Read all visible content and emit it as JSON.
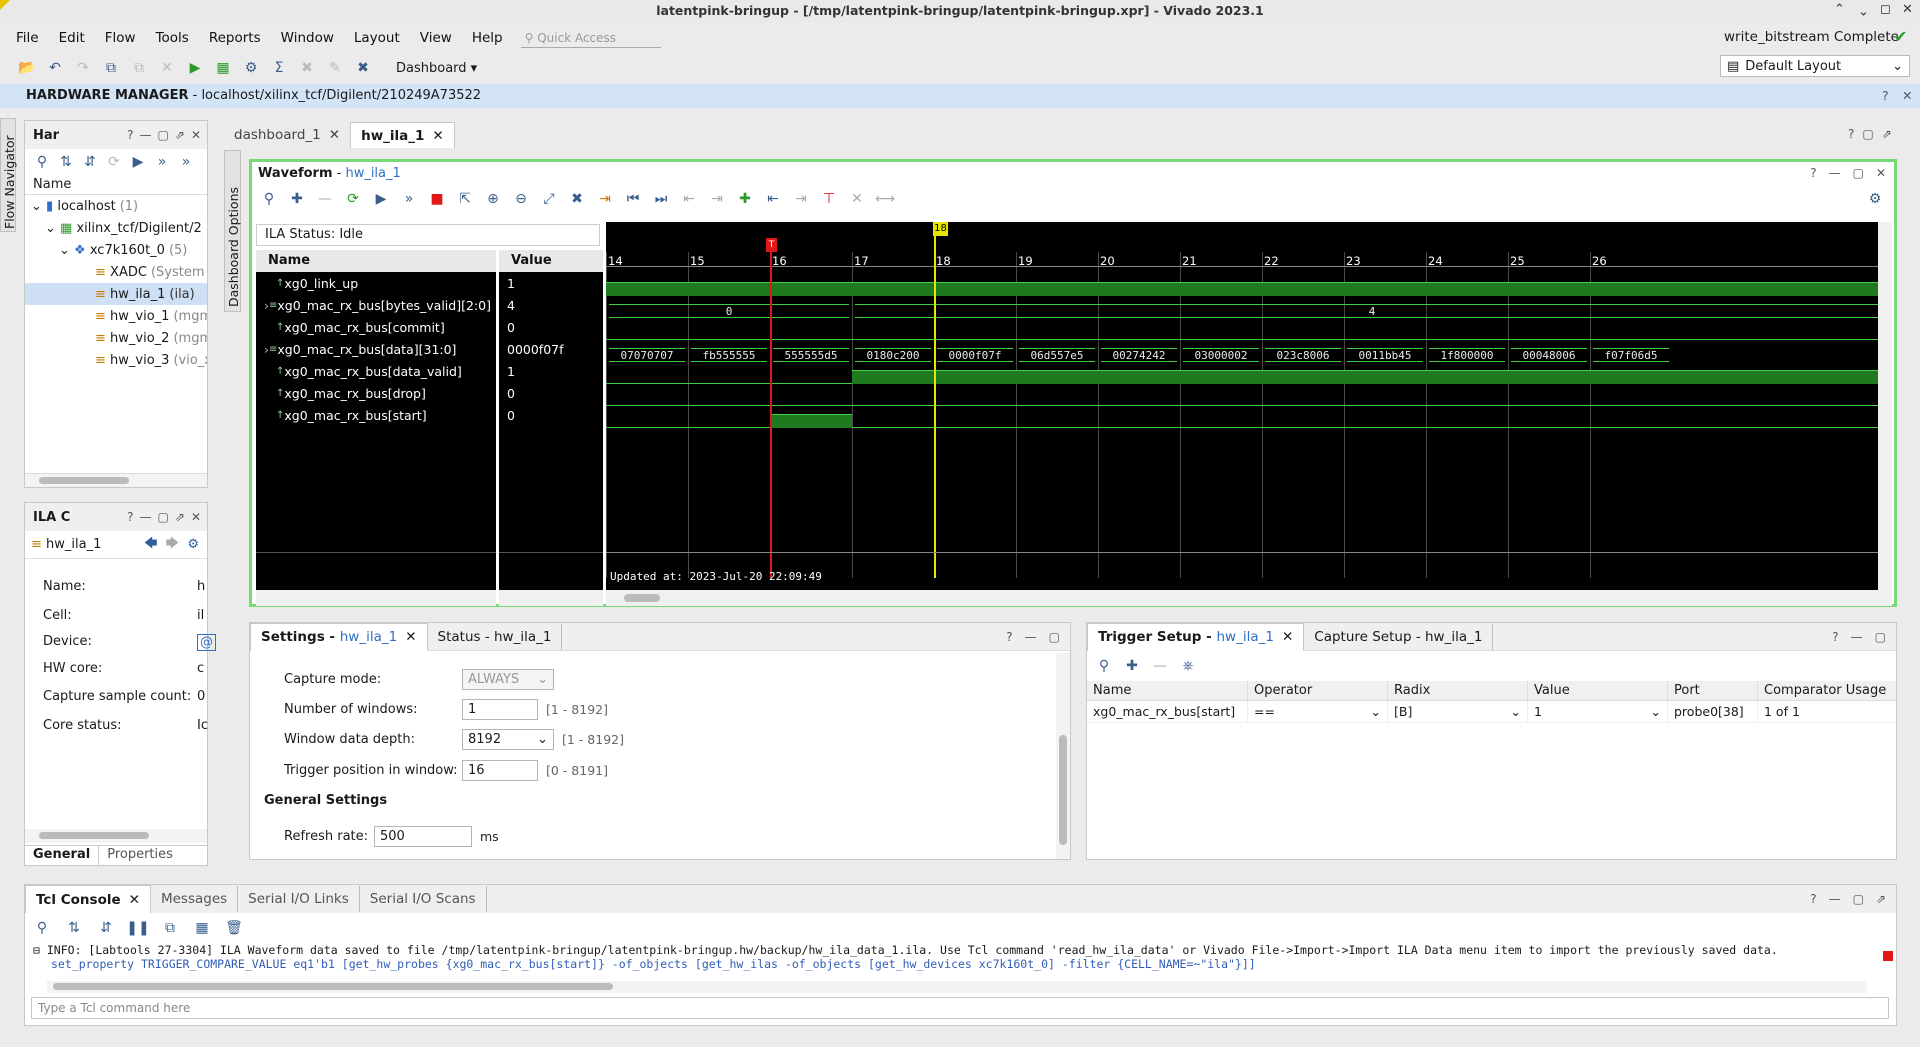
{
  "window": {
    "title": "latentpink-bringup - [/tmp/latentpink-bringup/latentpink-bringup.xpr] - Vivado 2023.1"
  },
  "menu": [
    "File",
    "Edit",
    "Flow",
    "Tools",
    "Reports",
    "Window",
    "Layout",
    "View",
    "Help"
  ],
  "quick_access": "Quick Access",
  "status_right": "write_bitstream Complete",
  "layout_select": "Default Layout",
  "dashboard_btn": "Dashboard",
  "hw_manager": {
    "title": "HARDWARE MANAGER",
    "path": " - localhost/xilinx_tcf/Digilent/210249A73522"
  },
  "flow_navigator": "Flow Navigator",
  "dashboard_options": "Dashboard Options",
  "hardware_panel": {
    "title": "Har",
    "col_name": "Name",
    "tree": [
      {
        "label": "localhost",
        "extra": "(1)"
      },
      {
        "label": "xilinx_tcf/Digilent/2",
        "extra": ""
      },
      {
        "label": "xc7k160t_0",
        "extra": "(5)"
      },
      {
        "label": "XADC",
        "extra": "(System"
      },
      {
        "label": "hw_ila_1",
        "extra": "(ila)"
      },
      {
        "label": "hw_vio_1",
        "extra": "(mgm"
      },
      {
        "label": "hw_vio_2",
        "extra": "(mgm"
      },
      {
        "label": "hw_vio_3",
        "extra": "(vio_x"
      }
    ]
  },
  "ila_core_panel": {
    "title": "ILA C",
    "selected": "hw_ila_1",
    "props": [
      {
        "k": "Name:",
        "v": "h"
      },
      {
        "k": "Cell:",
        "v": "il"
      },
      {
        "k": "Device:",
        "v": "@"
      },
      {
        "k": "HW core:",
        "v": "c"
      },
      {
        "k": "Capture sample count:",
        "v": "0"
      },
      {
        "k": "Core status:",
        "v": "Ic"
      }
    ],
    "tabs": [
      "General",
      "Properties"
    ]
  },
  "editor_tabs": [
    "dashboard_1",
    "hw_ila_1"
  ],
  "waveform": {
    "title": "Waveform",
    "link": "hw_ila_1",
    "ila_status": "ILA Status: Idle",
    "col_name": "Name",
    "col_value": "Value",
    "signals": [
      {
        "name": "xg0_link_up",
        "value": "1",
        "bus": false
      },
      {
        "name": "xg0_mac_rx_bus[bytes_valid][2:0]",
        "value": "4",
        "bus": true
      },
      {
        "name": "xg0_mac_rx_bus[commit]",
        "value": "0",
        "bus": false
      },
      {
        "name": "xg0_mac_rx_bus[data][31:0]",
        "value": "0000f07f",
        "bus": true
      },
      {
        "name": "xg0_mac_rx_bus[data_valid]",
        "value": "1",
        "bus": false
      },
      {
        "name": "xg0_mac_rx_bus[drop]",
        "value": "0",
        "bus": false
      },
      {
        "name": "xg0_mac_rx_bus[start]",
        "value": "0",
        "bus": false
      }
    ],
    "ticks": [
      "14",
      "15",
      "16",
      "17",
      "18",
      "19",
      "20",
      "21",
      "22",
      "23",
      "24",
      "25",
      "26"
    ],
    "trigger_marker": "T",
    "cursor_label": "18",
    "bytes_valid_values": [
      "0",
      "4"
    ],
    "data_words": [
      "07070707",
      "fb555555",
      "555555d5",
      "0180c200",
      "0000f07f",
      "06d557e5",
      "00274242",
      "03000002",
      "023c8006",
      "0011bb45",
      "1f800000",
      "00048006",
      "f07f06d5"
    ],
    "updated_at": "Updated at: 2023-Jul-20 22:09:49"
  },
  "settings_panel": {
    "tab1": "Settings",
    "tab1_link": "hw_ila_1",
    "tab2": "Status - hw_ila_1",
    "capture_mode_label": "Capture mode:",
    "capture_mode": "ALWAYS",
    "windows_label": "Number of windows:",
    "windows": "1",
    "windows_hint": "[1 - 8192]",
    "depth_label": "Window data depth:",
    "depth": "8192",
    "depth_hint": "[1 - 8192]",
    "trigpos_label": "Trigger position in window:",
    "trigpos": "16",
    "trigpos_hint": "[0 - 8191]",
    "general_header": "General Settings",
    "refresh_label": "Refresh rate:",
    "refresh": "500",
    "refresh_unit": "ms"
  },
  "trigger_panel": {
    "tab1": "Trigger Setup",
    "tab1_link": "hw_ila_1",
    "tab2": "Capture Setup - hw_ila_1",
    "cols": [
      "Name",
      "Operator",
      "Radix",
      "Value",
      "Port",
      "Comparator Usage"
    ],
    "row": {
      "name": "xg0_mac_rx_bus[start]",
      "op": "==",
      "radix": "[B]",
      "value": "1",
      "port": "probe0[38]",
      "usage": "1 of 1"
    }
  },
  "console": {
    "tabs": [
      "Tcl Console",
      "Messages",
      "Serial I/O Links",
      "Serial I/O Scans"
    ],
    "line1": "INFO: [Labtools 27-3304] ILA Waveform data saved to file /tmp/latentpink-bringup/latentpink-bringup.hw/backup/hw_ila_data_1.ila. Use Tcl command 'read_hw_ila_data' or Vivado File->Import->Import ILA Data menu item to import the previously saved data.",
    "line2": "set_property TRIGGER_COMPARE_VALUE eq1'b1 [get_hw_probes {xg0_mac_rx_bus[start]} -of_objects [get_hw_ilas -of_objects [get_hw_devices xc7k160t_0] -filter {CELL_NAME=~\"ila\"}]]",
    "placeholder": "Type a Tcl command here"
  },
  "colors": {
    "accent": "#2f6fc5",
    "wave_green": "#1f8a1f",
    "trigger_red": "#e01818",
    "cursor_yellow": "#e6e600",
    "frame_green": "#77d977",
    "header_blue": "#d4e4f7"
  }
}
